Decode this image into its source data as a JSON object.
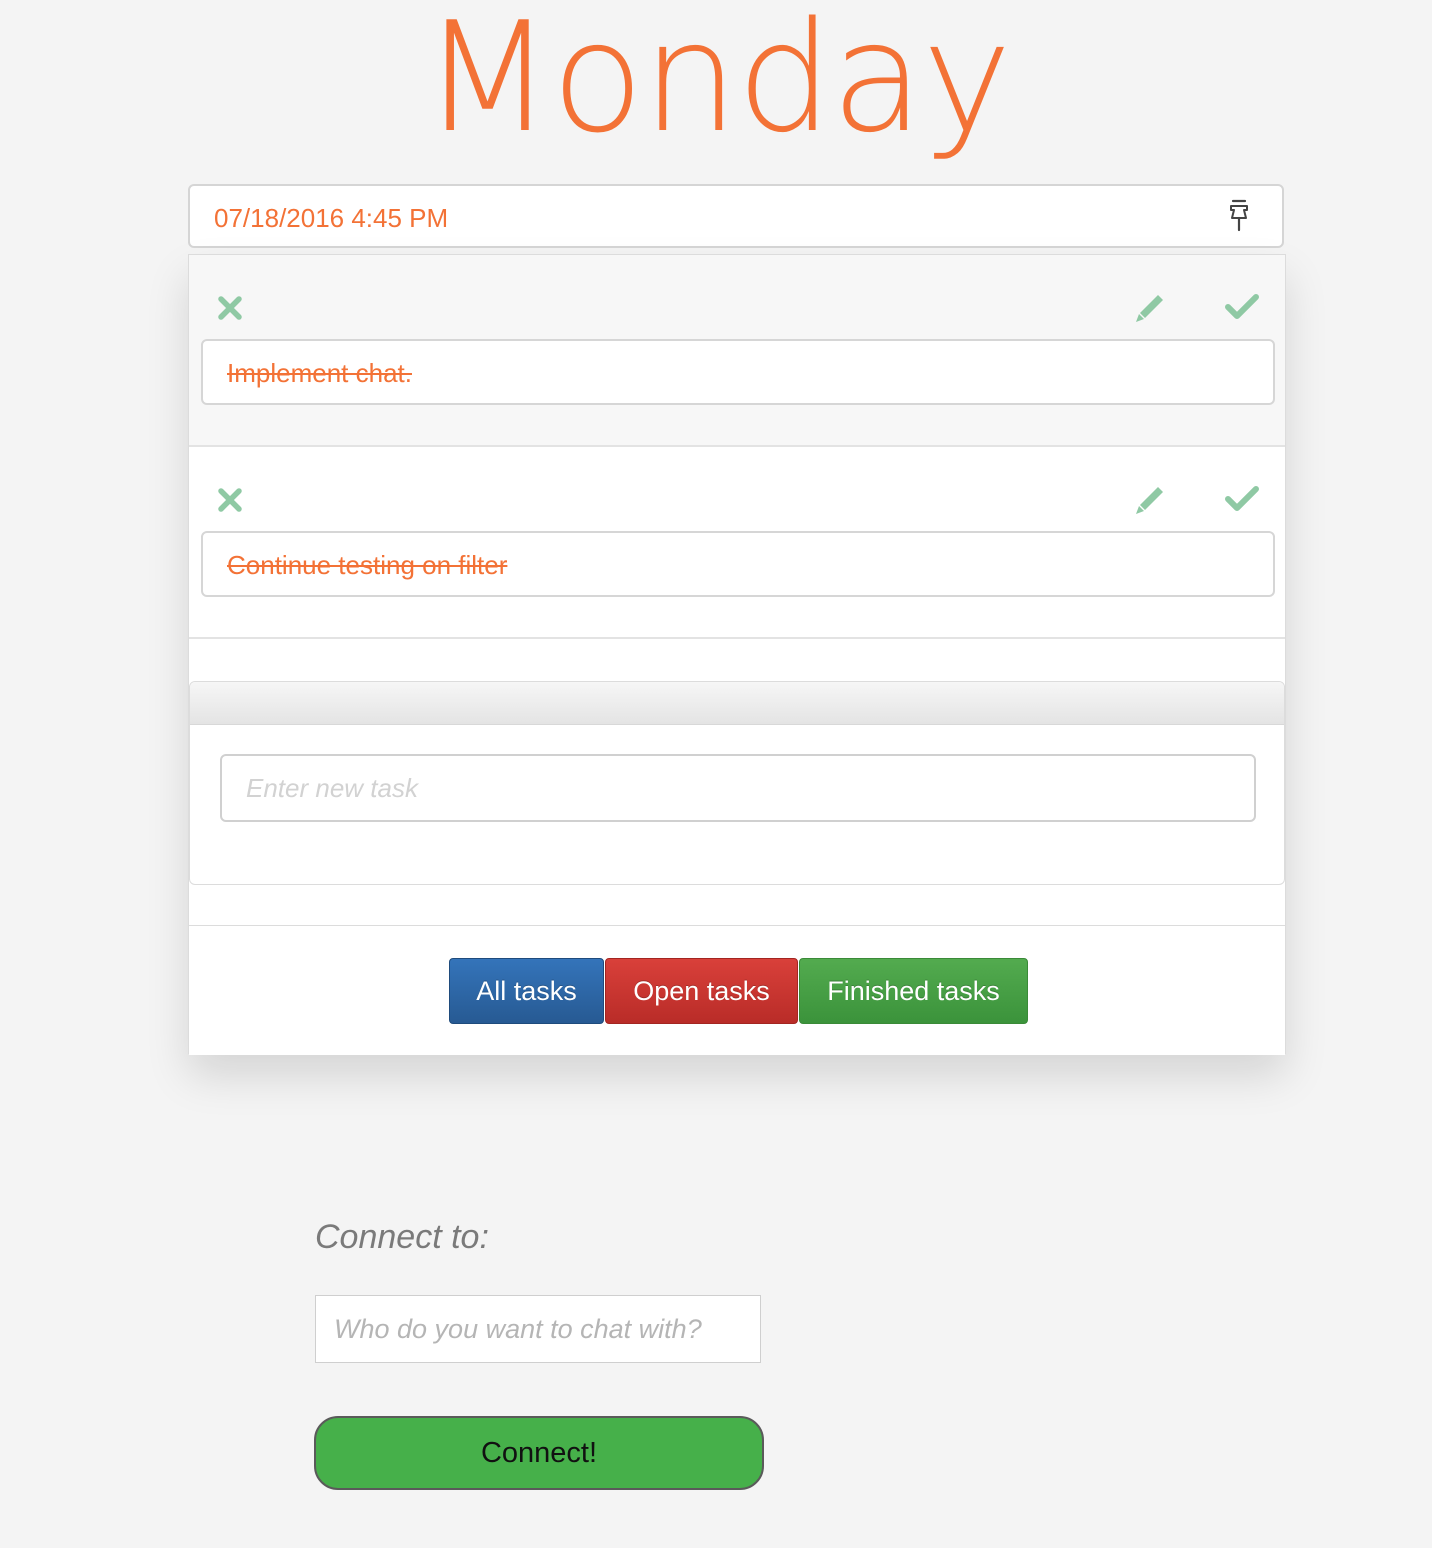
{
  "title": "Monday",
  "date_field": {
    "value": "07/18/2016 4:45 PM",
    "icon": "calendar-pin-icon"
  },
  "tasks": [
    {
      "text": "Implement chat.",
      "done": true
    },
    {
      "text": "Continue testing on filter",
      "done": true
    }
  ],
  "task_icons": {
    "delete": "x-icon",
    "edit": "pencil-icon",
    "complete": "check-icon"
  },
  "new_task": {
    "placeholder": "Enter new task",
    "value": ""
  },
  "filters": {
    "all": "All tasks",
    "open": "Open tasks",
    "finished": "Finished tasks"
  },
  "connect": {
    "label": "Connect to:",
    "placeholder": "Who do you want to chat with?",
    "button": "Connect!"
  },
  "colors": {
    "accent": "#f37236",
    "icon_green": "#8fc9a4",
    "all_btn": "#2f6aa9",
    "open_btn": "#c9302c",
    "finished_btn": "#449d44",
    "connect_btn": "#46b04a"
  }
}
